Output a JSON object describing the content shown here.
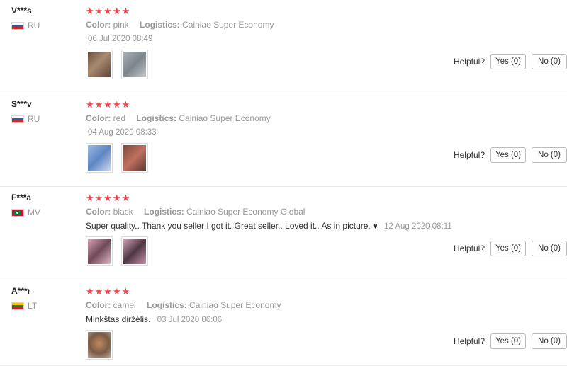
{
  "reviews": [
    {
      "user": "V***s",
      "country": "RU",
      "flag": "ru",
      "stars": "★★★★★",
      "rating": 5,
      "attrs": [
        {
          "label": "Color:",
          "value": "pink"
        },
        {
          "label": "Logistics:",
          "value": "Cainiao Super Economy"
        }
      ],
      "text": "",
      "date": "06 Jul 2020 08:49",
      "photos": [
        "#8b6f5a",
        "#9aa0a6"
      ],
      "helpful": {
        "label": "Helpful?",
        "yes": "Yes (0)",
        "no": "No (0)"
      }
    },
    {
      "user": "S***v",
      "country": "RU",
      "flag": "ru",
      "stars": "★★★★★",
      "rating": 5,
      "attrs": [
        {
          "label": "Color:",
          "value": "red"
        },
        {
          "label": "Logistics:",
          "value": "Cainiao Super Economy"
        }
      ],
      "text": "",
      "date": "04 Aug 2020 08:33",
      "photos": [
        "#7fa2d6",
        "#b86b5c"
      ],
      "helpful": {
        "label": "Helpful?",
        "yes": "Yes (0)",
        "no": "No (0)"
      }
    },
    {
      "user": "F***a",
      "country": "MV",
      "flag": "mv",
      "stars": "★★★★★",
      "rating": 5,
      "attrs": [
        {
          "label": "Color:",
          "value": "black"
        },
        {
          "label": "Logistics:",
          "value": "Cainiao Super Economy Global"
        }
      ],
      "text": "Super quality.. Thank you seller I got it. Great seller.. Loved it.. As in picture.",
      "heart": "♥",
      "date": "12 Aug 2020 08:11",
      "photos": [
        "#c48aa0",
        "#b07c97"
      ],
      "helpful": {
        "label": "Helpful?",
        "yes": "Yes (0)",
        "no": "No (0)"
      }
    },
    {
      "user": "A***r",
      "country": "LT",
      "flag": "lt",
      "stars": "★★★★★",
      "rating": 5,
      "attrs": [
        {
          "label": "Color:",
          "value": "camel"
        },
        {
          "label": "Logistics:",
          "value": "Cainiao Super Economy"
        }
      ],
      "text": "Minkštas diržėlis.",
      "date": "03 Jul 2020 06:06",
      "photos": [
        "#8a6a50"
      ],
      "helpful": {
        "label": "Helpful?",
        "yes": "Yes (0)",
        "no": "No (0)"
      }
    }
  ],
  "colors": {
    "star": "#f5424a",
    "muted": "#999999",
    "border": "#e8e8e8"
  }
}
